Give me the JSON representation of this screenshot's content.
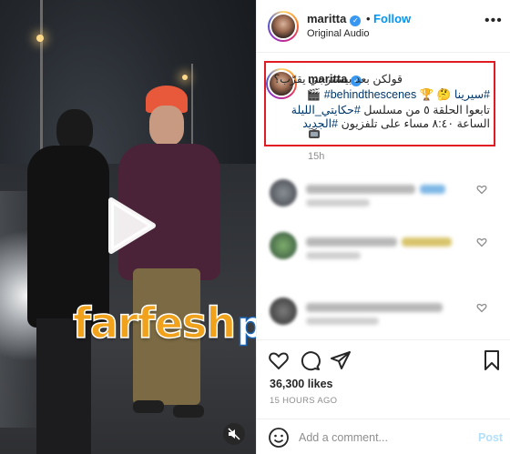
{
  "video": {
    "watermark_part1": "farfesh",
    "watermark_part2": "plus.com",
    "play_icon": "play-icon",
    "mute_icon": "muted-speaker-icon"
  },
  "header": {
    "username": "maritta",
    "dot": "•",
    "follow_label": "Follow",
    "subtitle": "Original Audio",
    "more_label": "•••"
  },
  "caption": {
    "username": "maritta",
    "line1": "قولكن بعد بيسترجي يقرّب؟",
    "line2_tag_sirina": "#سيرينا",
    "line2_tag_bts": "#behindthescenes",
    "line3": "تابعوا الحلقة ٥ من مسلسل",
    "line3_tag": "#حكايتي_الليلة",
    "line4": "الساعة ٨:٤٠ مساء على تلفزيون",
    "line4_tag": "#الجديد",
    "emoji_icons": [
      "clapper-board-icon",
      "thinking-face-icon",
      "trophy-icon",
      "television-icon"
    ]
  },
  "time": "15h",
  "comments_note": "blurred",
  "actions": {
    "icons": [
      "heart-icon",
      "comment-icon",
      "share-icon",
      "bookmark-icon"
    ],
    "likes": "36,300 likes",
    "posted_ago": "15 HOURS AGO"
  },
  "comment_box": {
    "placeholder": "Add a comment...",
    "post_label": "Post"
  },
  "colors": {
    "accent_blue": "#0095f6",
    "highlight_border": "#e01b24",
    "watermark_orange": "#f0a21c",
    "watermark_blue": "#1c66b5"
  }
}
